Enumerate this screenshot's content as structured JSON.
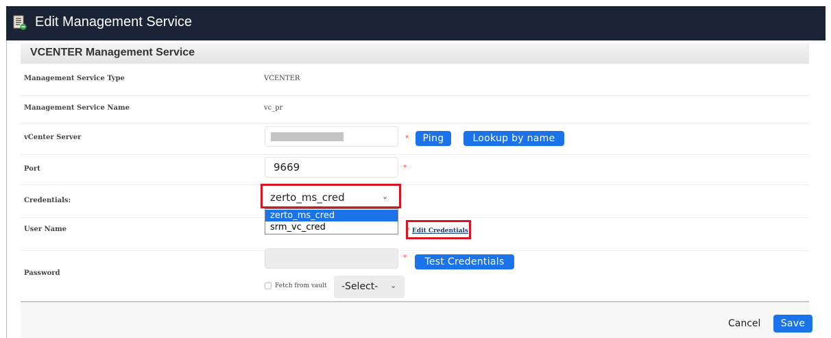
{
  "window": {
    "title": "Edit Management Service"
  },
  "section": {
    "title": "VCENTER Management Service"
  },
  "fields": {
    "type": {
      "label": "Management Service Type",
      "value": "VCENTER"
    },
    "name": {
      "label": "Management Service Name",
      "value": "vc_pr"
    },
    "server": {
      "label": "vCenter Server",
      "ping_label": "Ping",
      "lookup_label": "Lookup by name"
    },
    "port": {
      "label": "Port",
      "value": "9669"
    },
    "credentials": {
      "label": "Credentials:",
      "selected": "zerto_ms_cred",
      "options": [
        "zerto_ms_cred",
        "srm_vc_cred"
      ]
    },
    "username": {
      "label": "User Name",
      "edit_link": "Edit Credentials"
    },
    "password": {
      "label": "Password",
      "test_label": "Test Credentials",
      "fetch_label": "Fetch from vault",
      "vault_select": "-Select-"
    }
  },
  "footer": {
    "cancel_label": "Cancel",
    "save_label": "Save"
  },
  "colors": {
    "titlebar": "#1b2436",
    "accent": "#1a73e8",
    "highlight": "#d7141f",
    "required": "#e74c3c"
  },
  "icons": {
    "title": "document-icon",
    "dropdown": "chevron-down-icon"
  }
}
